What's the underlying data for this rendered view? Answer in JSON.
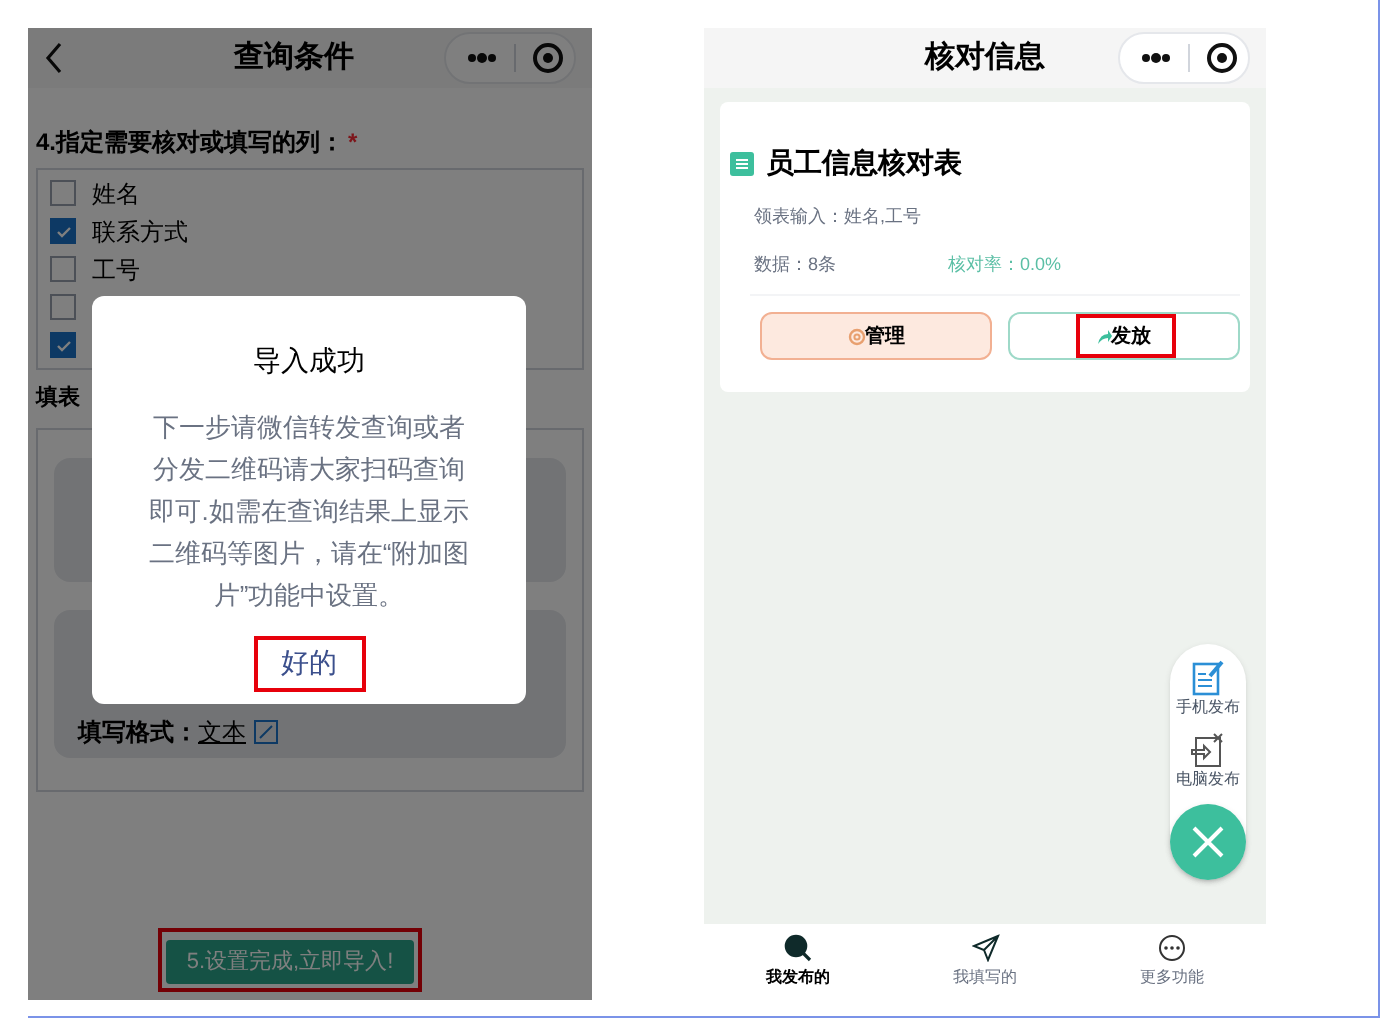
{
  "left_screen": {
    "nav": {
      "title": "查询条件"
    },
    "section_title": "4.指定需要核对或填写的列：",
    "required_mark": "*",
    "columns": [
      {
        "label": "姓名",
        "checked": false
      },
      {
        "label": "联系方式",
        "checked": true
      },
      {
        "label": "工号",
        "checked": false
      },
      {
        "checked": false
      },
      {
        "checked": true
      }
    ],
    "fill_label": "填表",
    "cards": [
      {
        "kind": "blank"
      },
      {
        "kind": "format",
        "format_label": "填写格式：",
        "format_value": "文本"
      }
    ],
    "submit_button": "5.设置完成,立即导入!",
    "dialog": {
      "title": "导入成功",
      "message": "下一步请微信转发查询或者分发二维码请大家扫码查询即可.如需在查询结果上显示二维码等图片，请在“附加图片”功能中设置。",
      "confirm": "好的"
    }
  },
  "right_screen": {
    "nav": {
      "title": "核对信息"
    },
    "card": {
      "title": "员工信息核对表",
      "input_label": "领表输入：姓名,工号",
      "data_count": "数据：8条",
      "rate": "核对率：0.0%",
      "manage_button": "管理",
      "publish_button": "发放"
    },
    "fab_items": [
      {
        "kind": "phone",
        "label": "手机发布"
      },
      {
        "kind": "computer",
        "label": "电脑发布"
      }
    ],
    "tabs": [
      {
        "kind": "search",
        "label": "我发布的",
        "selected": true
      },
      {
        "kind": "send",
        "label": "我填写的",
        "selected": false
      },
      {
        "kind": "more",
        "label": "更多功能",
        "selected": false
      }
    ]
  }
}
